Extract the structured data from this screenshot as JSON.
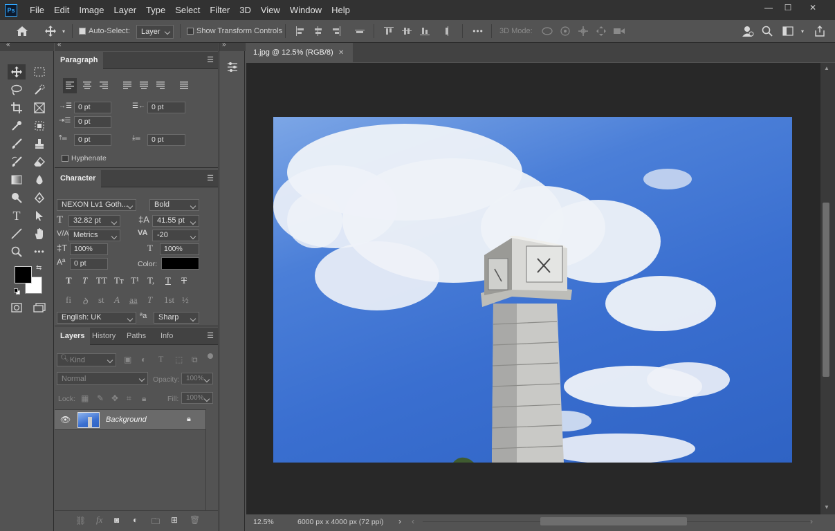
{
  "app": {
    "logo": "Ps"
  },
  "menu": [
    "File",
    "Edit",
    "Image",
    "Layer",
    "Type",
    "Select",
    "Filter",
    "3D",
    "View",
    "Window",
    "Help"
  ],
  "window_controls": {
    "minimize": "—",
    "maximize": "☐",
    "close": "✕"
  },
  "options": {
    "auto_select_label": "Auto-Select:",
    "auto_select_value": "Layer",
    "show_transform_label": "Show Transform Controls",
    "mode_3d_label": "3D Mode:",
    "more": "•••"
  },
  "paragraph": {
    "tab": "Paragraph",
    "indent_left": "0 pt",
    "indent_right": "0 pt",
    "indent_first": "0 pt",
    "space_before": "0 pt",
    "space_after": "0 pt",
    "hyphenate": "Hyphenate"
  },
  "character": {
    "tab": "Character",
    "font_family": "NEXON Lv1 Goth...",
    "font_style": "Bold",
    "font_size": "32.82 pt",
    "leading": "41.55 pt",
    "kerning": "Metrics",
    "tracking": "-20",
    "vertical_scale": "100%",
    "horizontal_scale": "100%",
    "baseline_shift": "0 pt",
    "color_label": "Color:",
    "color": "#000000",
    "language": "English: UK",
    "aa_label": "ªa",
    "antialias": "Sharp",
    "type_buttons": [
      "T",
      "T",
      "TT",
      "Tт",
      "T¹",
      "T,",
      "T",
      "T"
    ],
    "opentype_buttons": [
      "fi",
      "ꝺ",
      "st",
      "A",
      "aa",
      "T",
      "1st",
      "½"
    ]
  },
  "layers": {
    "tabs": [
      "Layers",
      "History",
      "Paths",
      "Info"
    ],
    "kind_placeholder": "Kind",
    "blend_mode": "Normal",
    "opacity_label": "Opacity:",
    "opacity": "100%",
    "lock_label": "Lock:",
    "fill_label": "Fill:",
    "fill": "100%",
    "layer_name": "Background"
  },
  "document": {
    "tab_title": "1.jpg @ 12.5% (RGB/8)",
    "zoom": "12.5%",
    "info": "6000 px x 4000 px (72 ppi)"
  },
  "colors": {
    "foreground": "#000000",
    "background": "#ffffff",
    "accent": "#31a8ff",
    "sky": "#3a6fd0"
  }
}
